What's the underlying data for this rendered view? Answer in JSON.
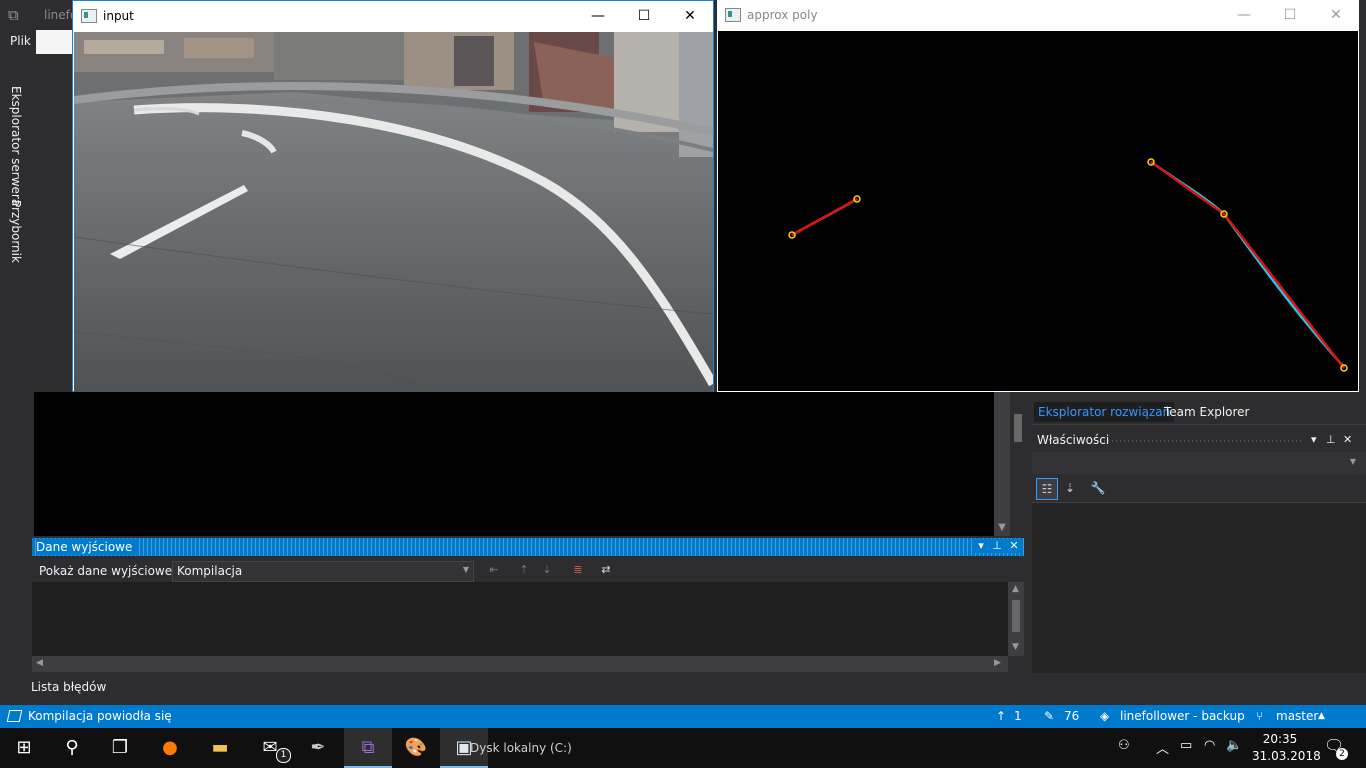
{
  "vs": {
    "window_title": "linefo",
    "menu_first": "Plik",
    "side_tabs": [
      "Eksplorator serwera",
      "Przybornik"
    ],
    "output": {
      "title": "Dane wyjściowe",
      "show_label": "Pokaż dane wyjściowe z:",
      "source": "Kompilacja"
    },
    "error_list_tab": "Lista błędów",
    "solution_tabs": [
      "Eksplorator rozwiązań",
      "Team Explorer"
    ],
    "properties_title": "Właściwości",
    "status": {
      "message": "Kompilacja powiodła się",
      "up_count": "1",
      "changes": "76",
      "repo": "linefollower - backup",
      "branch": "master"
    }
  },
  "windows": {
    "input": {
      "title": "input"
    },
    "approx_poly": {
      "title": "approx poly",
      "line_colors": {
        "approx": "#e01010",
        "contour": "#22c8e8",
        "vertex": "#ffd400"
      }
    }
  },
  "taskbar": {
    "disk_label": "Dysk lokalny (C:)",
    "time": "20:35",
    "date": "31.03.2018",
    "notification_count": "2",
    "mail_badge": "1",
    "apps": [
      "start",
      "search",
      "task-view",
      "firefox",
      "file-explorer",
      "mail",
      "inkscape",
      "visual-studio",
      "paint",
      "opencv-window"
    ]
  }
}
